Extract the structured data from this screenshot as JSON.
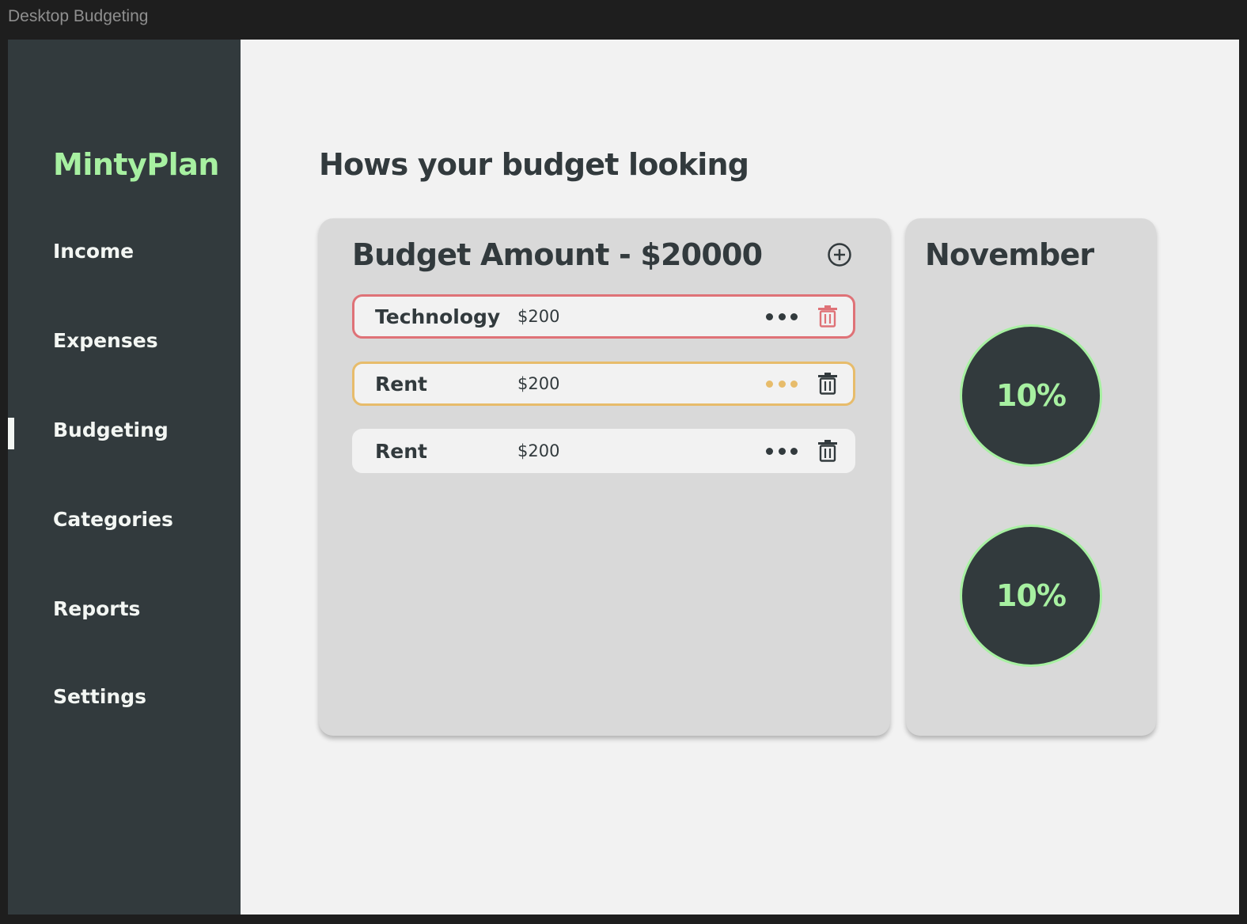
{
  "window": {
    "title": "Desktop Budgeting"
  },
  "sidebar": {
    "brand": "MintyPlan",
    "items": [
      {
        "label": "Income",
        "active": false
      },
      {
        "label": "Expenses",
        "active": false
      },
      {
        "label": "Budgeting",
        "active": true
      },
      {
        "label": "Categories",
        "active": false
      },
      {
        "label": "Reports",
        "active": false
      },
      {
        "label": "Settings",
        "active": false
      }
    ]
  },
  "main": {
    "title": "Hows your budget looking",
    "budget": {
      "heading": "Budget Amount - $20000",
      "add_icon": "plus-circle-icon",
      "rows": [
        {
          "name": "Technology",
          "amount": "$200",
          "status_color": "#df7277",
          "more_color": "#323a3d",
          "delete_color": "#df7277"
        },
        {
          "name": "Rent",
          "amount": "$200",
          "status_color": "#e7bc6b",
          "more_color": "#e7bc6b",
          "delete_color": "#323a3d"
        },
        {
          "name": "Rent",
          "amount": "$200",
          "status_color": "#f2f2f2",
          "more_color": "#323a3d",
          "delete_color": "#323a3d"
        }
      ]
    },
    "month": {
      "title": "November",
      "rings": [
        {
          "label": "10%"
        },
        {
          "label": "10%"
        }
      ]
    }
  },
  "colors": {
    "sidebar_bg": "#323a3d",
    "accent_mint": "#a7f0a1",
    "card_bg": "#d9d9d9",
    "page_bg": "#f2f2f2",
    "danger": "#df7277",
    "warning": "#e7bc6b"
  }
}
